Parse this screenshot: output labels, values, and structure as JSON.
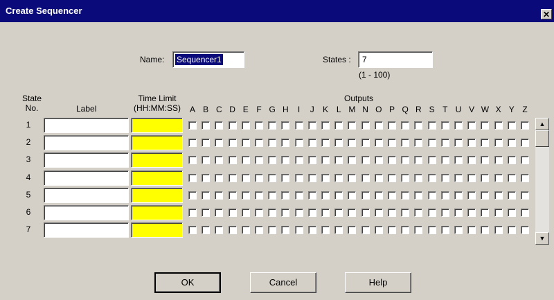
{
  "dialog": {
    "title": "Create Sequencer",
    "close_label": "✕"
  },
  "form": {
    "name_label": "Name:",
    "name_value": "Sequencer1",
    "states_label": "States :",
    "states_value": "7",
    "states_range": "(1 - 100)"
  },
  "table": {
    "state_header_line1": "State",
    "state_header_line2": "No.",
    "label_header": "Label",
    "time_header_line1": "Time Limit",
    "time_header_line2": "(HH:MM:SS)",
    "outputs_header": "Outputs",
    "output_letters": [
      "A",
      "B",
      "C",
      "D",
      "E",
      "F",
      "G",
      "H",
      "I",
      "J",
      "K",
      "L",
      "M",
      "N",
      "O",
      "P",
      "Q",
      "R",
      "S",
      "T",
      "U",
      "V",
      "W",
      "X",
      "Y",
      "Z"
    ],
    "rows": [
      {
        "num": "1",
        "label": "",
        "time": ""
      },
      {
        "num": "2",
        "label": "",
        "time": ""
      },
      {
        "num": "3",
        "label": "",
        "time": ""
      },
      {
        "num": "4",
        "label": "",
        "time": ""
      },
      {
        "num": "5",
        "label": "",
        "time": ""
      },
      {
        "num": "6",
        "label": "",
        "time": ""
      },
      {
        "num": "7",
        "label": "",
        "time": ""
      }
    ],
    "time_cell_color": "#ffff00"
  },
  "buttons": {
    "ok": "OK",
    "cancel": "Cancel",
    "help": "Help"
  },
  "colors": {
    "titlebar": "#0a0a7a",
    "face": "#d4d0c8"
  }
}
